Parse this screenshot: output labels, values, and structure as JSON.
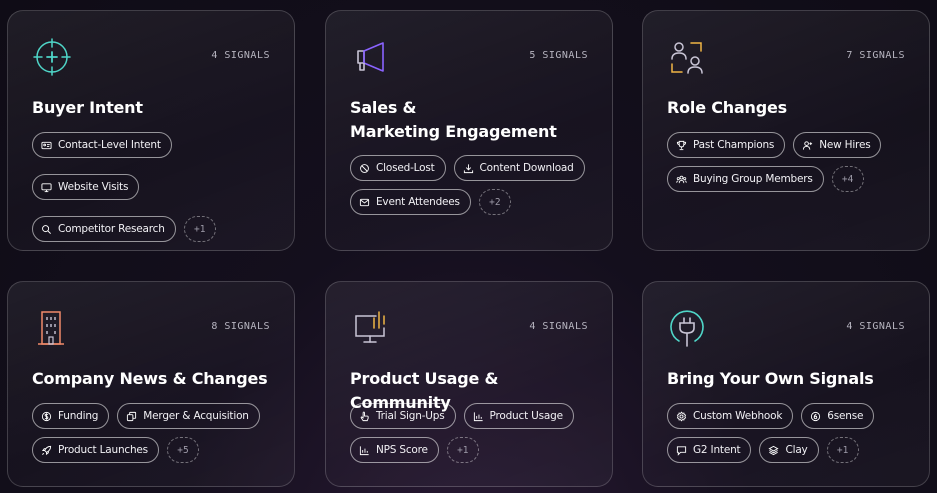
{
  "cards": [
    {
      "id": "buyer-intent",
      "title": "Buyer Intent",
      "signals": "4 SIGNALS",
      "icon": "crosshair-icon",
      "icon_color": "#4fd6c8",
      "chips": [
        {
          "label": "Contact-Level Intent",
          "icon": "id-card-icon"
        },
        {
          "label": "Website Visits",
          "icon": "monitor-icon"
        },
        {
          "label": "Competitor Research",
          "icon": "search-icon"
        }
      ],
      "more": "+1"
    },
    {
      "id": "sales-marketing-engagement",
      "title_line1": "Sales &",
      "title_line2": "Marketing Engagement",
      "signals": "5 SIGNALS",
      "icon": "megaphone-icon",
      "icon_color": "#8a63ff",
      "chips": [
        {
          "label": "Closed-Lost",
          "icon": "ban-icon"
        },
        {
          "label": "Content Download",
          "icon": "download-icon"
        },
        {
          "label": "Event Attendees",
          "icon": "mail-icon"
        }
      ],
      "more": "+2"
    },
    {
      "id": "role-changes",
      "title": "Role Changes",
      "signals": "7 SIGNALS",
      "icon": "people-swap-icon",
      "icon_color": "#f0b545",
      "chips": [
        {
          "label": "Past Champions",
          "icon": "trophy-icon"
        },
        {
          "label": "New Hires",
          "icon": "user-plus-icon"
        },
        {
          "label": "Buying Group Members",
          "icon": "group-icon"
        }
      ],
      "more": "+4"
    },
    {
      "id": "company-news",
      "title": "Company News & Changes",
      "signals": "8 SIGNALS",
      "icon": "building-icon",
      "icon_color": "#f08a6a",
      "chips": [
        {
          "label": "Funding",
          "icon": "dollar-icon"
        },
        {
          "label": "Merger & Acquisition",
          "icon": "copy-icon"
        },
        {
          "label": "Product Launches",
          "icon": "rocket-icon"
        }
      ],
      "more": "+5"
    },
    {
      "id": "product-usage",
      "title": "Product Usage & Community",
      "signals": "4 SIGNALS",
      "icon": "monitor-chart-icon",
      "icon_color": "#f0b545",
      "chips": [
        {
          "label": "Trial Sign-Ups",
          "icon": "pointer-icon"
        },
        {
          "label": "Product Usage",
          "icon": "bar-chart-icon"
        },
        {
          "label": "NPS Score",
          "icon": "bar-chart-icon"
        }
      ],
      "more": "+1"
    },
    {
      "id": "bring-your-own",
      "title": "Bring Your Own Signals",
      "signals": "4 SIGNALS",
      "icon": "plug-icon",
      "icon_color": "#4fd6c8",
      "chips": [
        {
          "label": "Custom Webhook",
          "icon": "gear-icon"
        },
        {
          "label": "6sense",
          "icon": "six-icon"
        },
        {
          "label": "G2 Intent",
          "icon": "chat-icon"
        },
        {
          "label": "Clay",
          "icon": "layers-icon"
        }
      ],
      "more": "+1"
    }
  ]
}
